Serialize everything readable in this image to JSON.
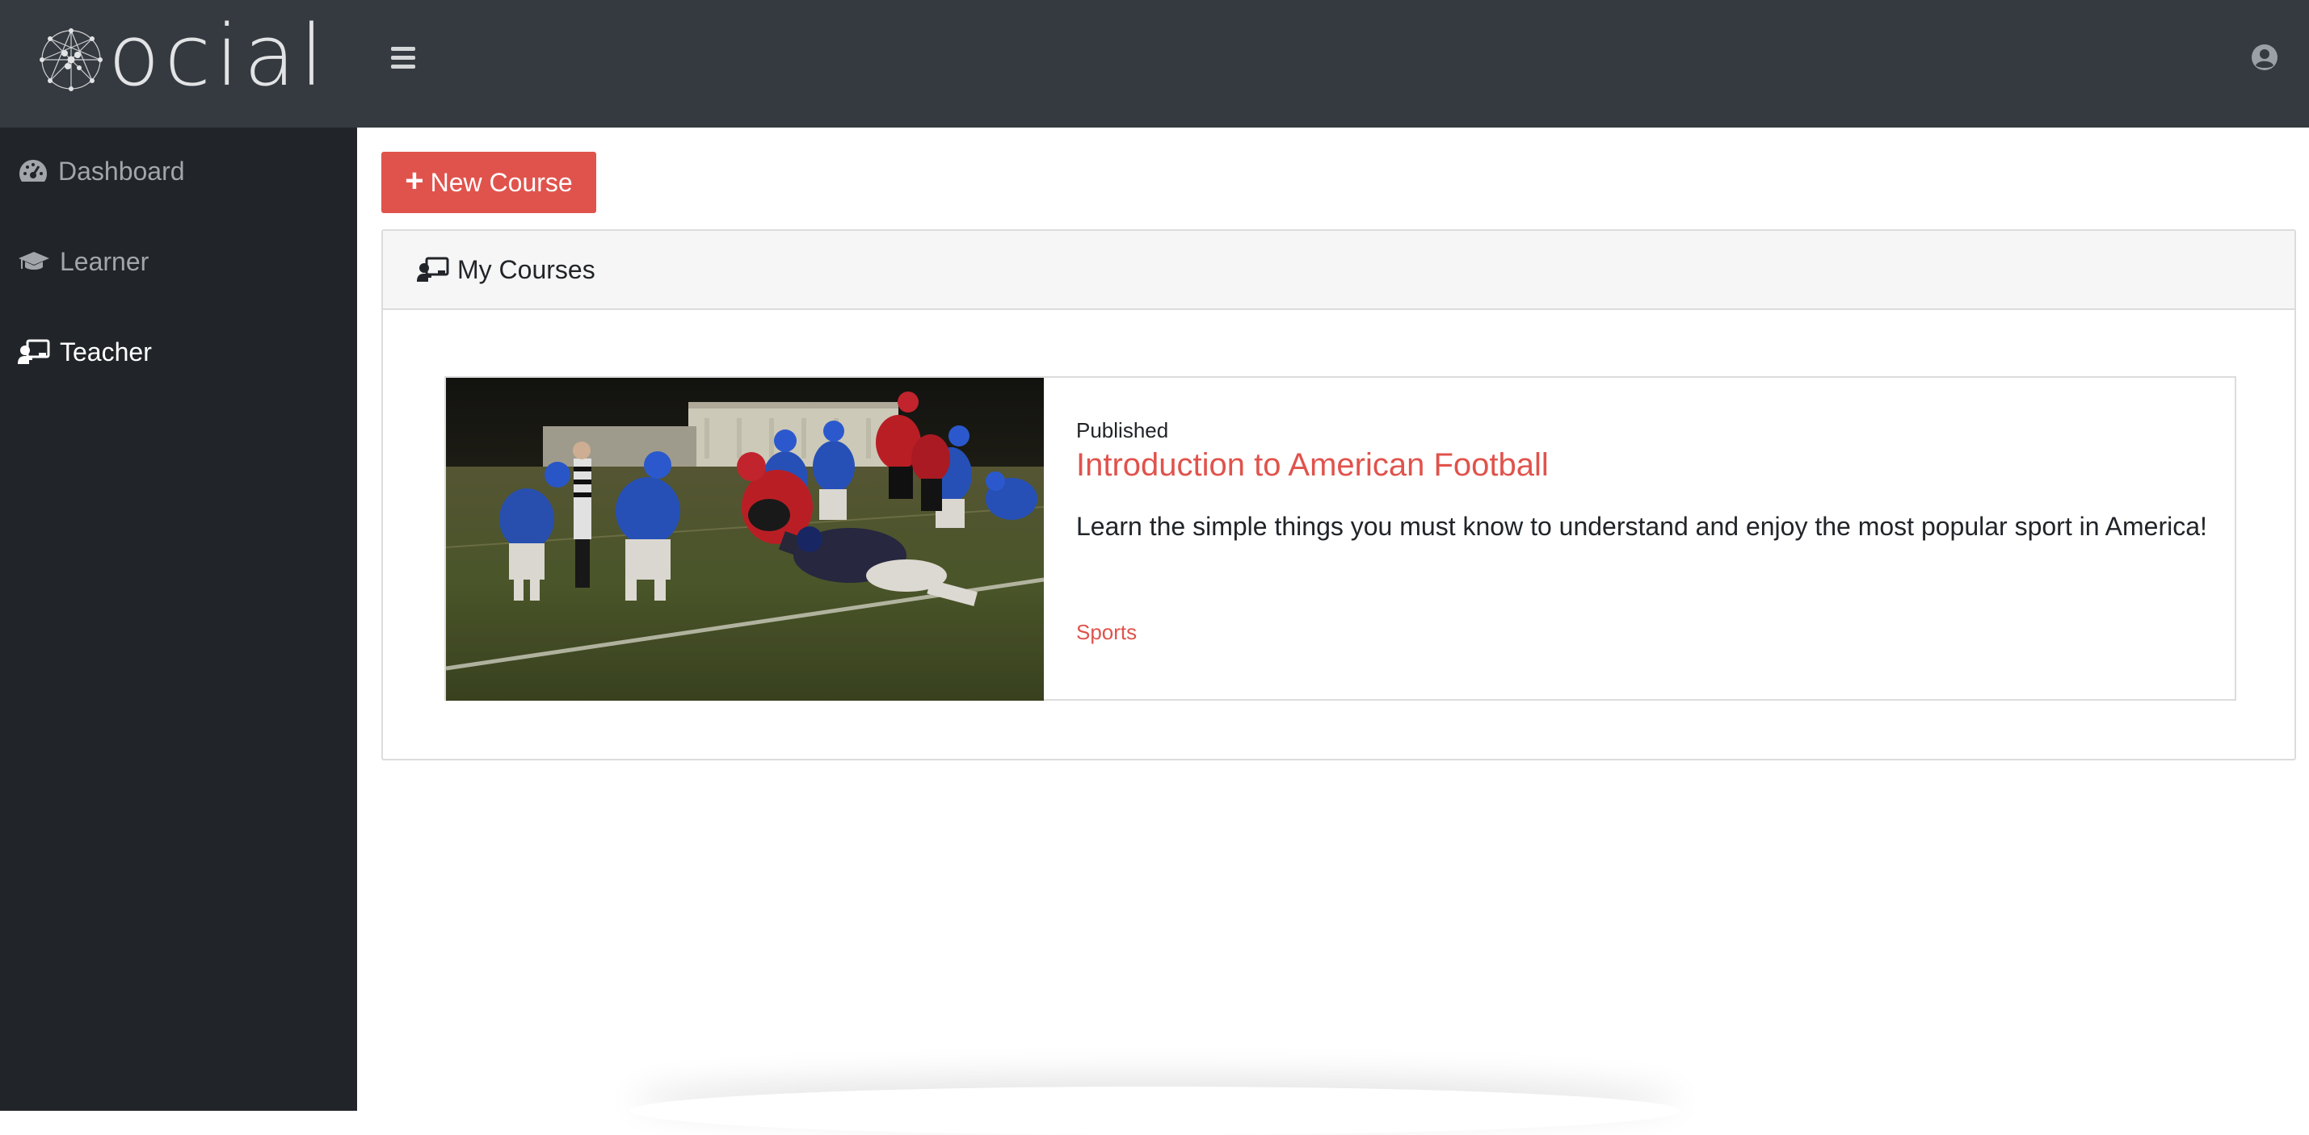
{
  "brand": {
    "wordmark": "ocial"
  },
  "navbar": {
    "menu_icon": "hamburger-icon",
    "user_icon": "user-circle-icon"
  },
  "sidebar": {
    "items": [
      {
        "label": "Dashboard",
        "icon": "tachometer-icon",
        "active": false
      },
      {
        "label": "Learner",
        "icon": "graduation-cap-icon",
        "active": false
      },
      {
        "label": "Teacher",
        "icon": "chalkboard-teacher-icon",
        "active": true
      }
    ]
  },
  "toolbar": {
    "new_course_label": "New Course"
  },
  "my_courses": {
    "title": "My Courses",
    "courses": [
      {
        "status": "Published",
        "title": "Introduction to American Football",
        "description": "Learn the simple things you must know to understand and enjoy the most popular sport in America!",
        "category": "Sports"
      }
    ]
  },
  "colors": {
    "accent": "#e0534c",
    "navbar_bg": "#343a40",
    "sidebar_bg": "#212529",
    "panel_header_bg": "#f6f6f6"
  }
}
